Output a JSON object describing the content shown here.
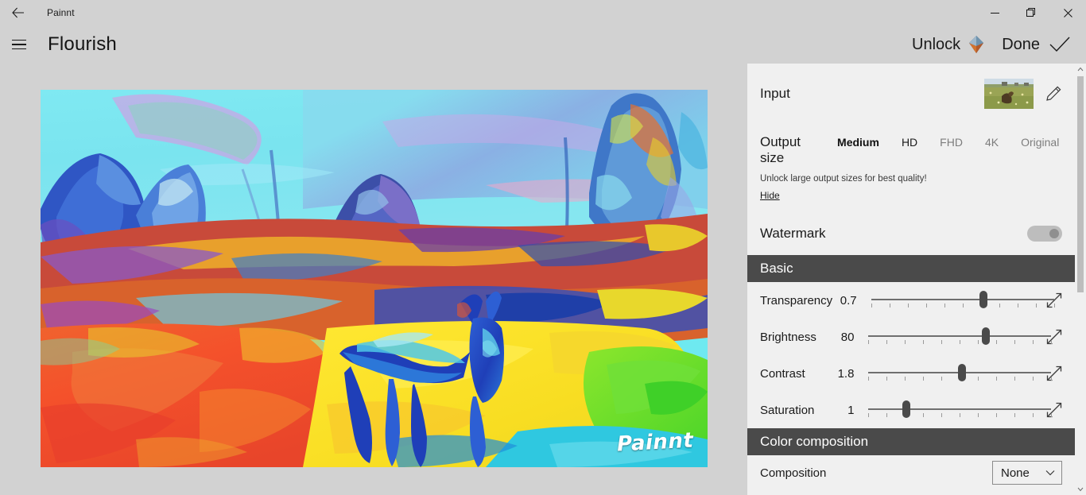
{
  "window": {
    "app_name": "Painnt",
    "back_icon": "back-arrow-icon",
    "minimize_label": "─",
    "restore_label": "restore-icon",
    "close_label": "×"
  },
  "commandbar": {
    "menu_icon": "hamburger-menu-icon",
    "doc_title": "Flourish",
    "unlock_label": "Unlock",
    "unlock_icon": "gem-diamond-icon",
    "done_label": "Done",
    "done_icon": "checkmark-icon"
  },
  "canvas": {
    "watermark": "Painnt"
  },
  "panel": {
    "input": {
      "label": "Input",
      "thumbnail_name": "input-thumbnail",
      "edit_icon": "pencil-icon"
    },
    "output_size": {
      "label": "Output size",
      "options": [
        {
          "label": "Medium",
          "state": "selected"
        },
        {
          "label": "HD",
          "state": "available"
        },
        {
          "label": "FHD",
          "state": "locked"
        },
        {
          "label": "4K",
          "state": "locked"
        },
        {
          "label": "Original",
          "state": "locked"
        }
      ],
      "hint": "Unlock large output sizes for best quality!",
      "hide_link": "Hide"
    },
    "watermark": {
      "label": "Watermark",
      "toggle_state": "off"
    },
    "basic": {
      "section_title": "Basic",
      "sliders": [
        {
          "label": "Transparency",
          "value": "0.7",
          "pos_pct": 68.5,
          "ticks": 11,
          "expand_icon": "expand-diagonal-icon"
        },
        {
          "label": "Brightness",
          "value": "80",
          "pos_pct": 70.5,
          "ticks": 11,
          "expand_icon": "expand-diagonal-icon"
        },
        {
          "label": "Contrast",
          "value": "1.8",
          "pos_pct": 56.0,
          "ticks": 11,
          "expand_icon": "expand-diagonal-icon"
        },
        {
          "label": "Saturation",
          "value": "1",
          "pos_pct": 22.5,
          "ticks": 11,
          "expand_icon": "expand-diagonal-icon"
        }
      ]
    },
    "color_composition": {
      "section_title": "Color composition",
      "composition_label": "Composition",
      "composition_value": "None",
      "chevron_icon": "chevron-down-icon"
    }
  },
  "scrollbar": {
    "up_icon": "chevron-up-icon",
    "down_icon": "chevron-down-icon"
  },
  "colors": {
    "chrome": "#d2d2d2",
    "panel": "#f0f0f0",
    "section_header": "#4a4a4a",
    "accent_text": "#1a1a1a"
  }
}
